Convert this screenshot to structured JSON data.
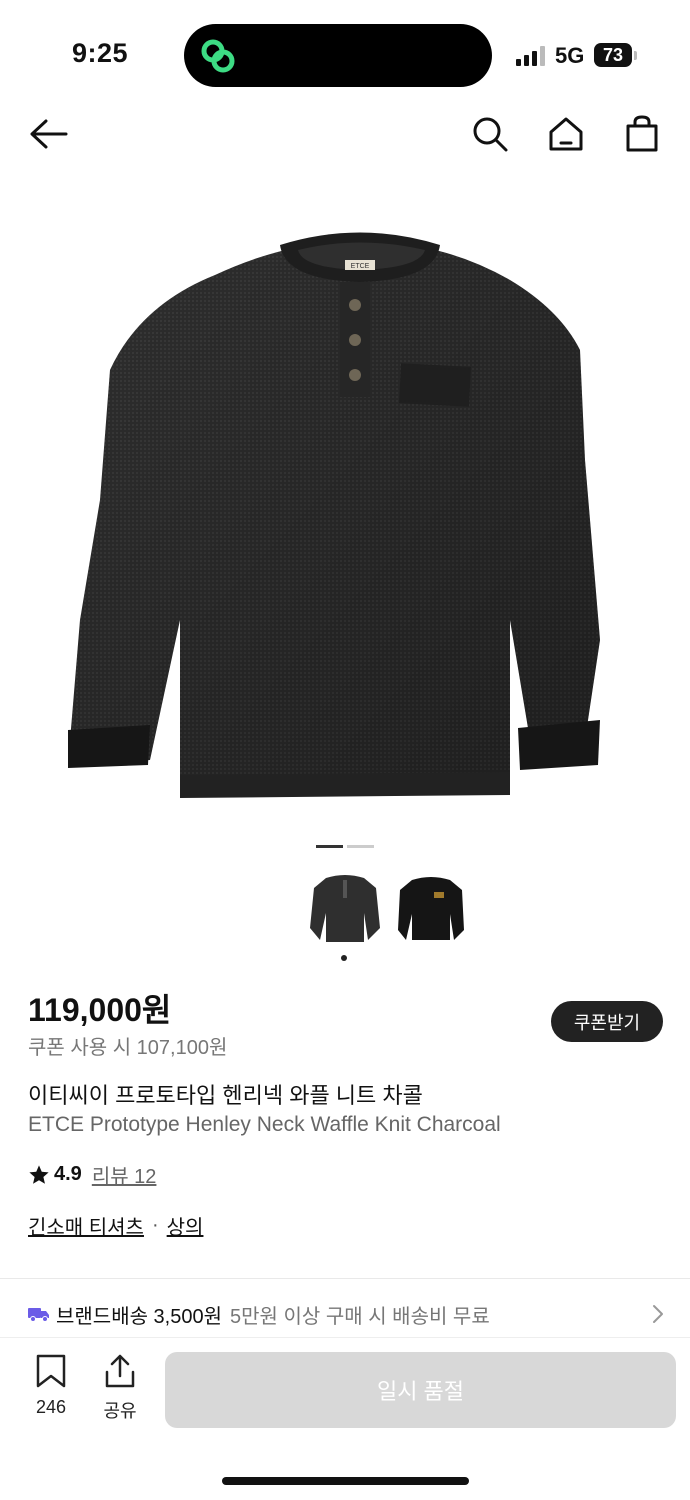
{
  "status_bar": {
    "time": "9:25",
    "network": "5G",
    "battery": "73"
  },
  "nav": {
    "icons": [
      "back-arrow-icon",
      "search-icon",
      "home-icon",
      "shopping-bag-icon"
    ]
  },
  "product": {
    "brand_mark": "ETCE",
    "price": "119,000원",
    "coupon_price": "쿠폰 사용 시 107,100원",
    "coupon_button": "쿠폰받기",
    "name_ko": "이티씨이 프로토타입 헨리넥 와플 니트 차콜",
    "name_en": "ETCE Prototype Henley Neck Waffle Knit Charcoal",
    "rating": "4.9",
    "review": "리뷰 12",
    "categories": [
      "긴소매 티셔츠",
      "상의"
    ],
    "category_separator": "·",
    "image_pager": {
      "total": 2,
      "current": 1
    }
  },
  "shipping": {
    "title": "브랜드배송 3,500원",
    "note": "5만원 이상 구매 시 배송비 무료"
  },
  "bottom_bar": {
    "bookmark_count": "246",
    "share_label": "공유",
    "purchase_label": "일시 품절"
  },
  "colors": {
    "accent_dark": "#222222",
    "disabled_button": "#d8d8d8",
    "truck_icon": "#6b5ce7",
    "island_logo": "#3ddc84"
  }
}
